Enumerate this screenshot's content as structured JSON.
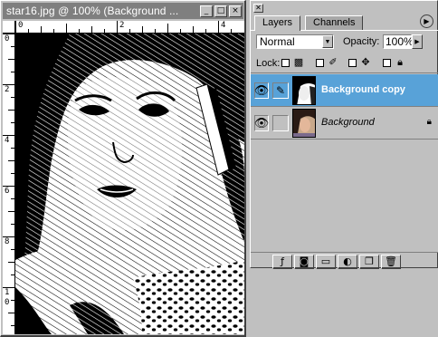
{
  "document": {
    "title": "star16.jpg @ 100% (Background ...",
    "buttons": {
      "minimize": "_",
      "maximize": "□",
      "close": "×"
    },
    "ruler_h": [
      "0",
      "2",
      "4"
    ],
    "ruler_v": [
      "0",
      "2",
      "4",
      "6",
      "8",
      "1",
      "0"
    ]
  },
  "palette": {
    "tabs": [
      "Layers",
      "Channels"
    ],
    "blend_mode": "Normal",
    "opacity_label": "Opacity:",
    "opacity_value": "100%",
    "lock_label": "Lock:",
    "layers": [
      {
        "name": "Background copy",
        "selected": true,
        "visible": true
      },
      {
        "name": "Background",
        "selected": false,
        "visible": true,
        "locked": true
      }
    ],
    "bottom_icons": [
      "layer-style-icon",
      "mask-icon",
      "new-set-icon",
      "adjustment-layer-icon",
      "new-layer-icon",
      "trash-icon"
    ]
  },
  "colors": {
    "selection": "#58a2d8",
    "face": "#c0c0c0",
    "title_inactive": "#7f7f7f"
  }
}
